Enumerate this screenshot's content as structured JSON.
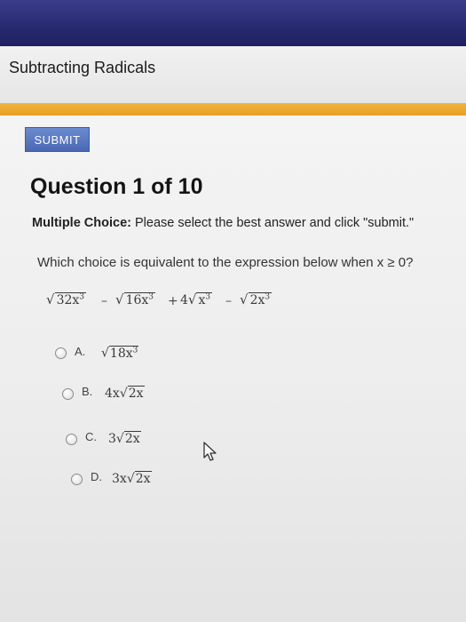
{
  "header": {
    "title": "Subtracting Radicals"
  },
  "toolbar": {
    "submit_label": "SUBMIT"
  },
  "question": {
    "heading": "Question 1 of 10",
    "instruction_bold": "Multiple Choice:",
    "instruction_rest": " Please select the best answer and click \"submit.\"",
    "prompt": "Which choice is equivalent to the expression below when x ≥ 0?",
    "expression": {
      "term1": "32x",
      "term2": "16x",
      "coef3": "4",
      "term3": "x",
      "term4": "2x",
      "exp": "3",
      "minus": "–",
      "plus": "+"
    }
  },
  "choices": [
    {
      "letter": "A.",
      "coef": "",
      "radicand": "18x",
      "exp": "3"
    },
    {
      "letter": "B.",
      "coef": "4x",
      "radicand": "2x",
      "exp": ""
    },
    {
      "letter": "C.",
      "coef": "3",
      "radicand": "2x",
      "exp": ""
    },
    {
      "letter": "D.",
      "coef": "3x",
      "radicand": "2x",
      "exp": ""
    }
  ]
}
